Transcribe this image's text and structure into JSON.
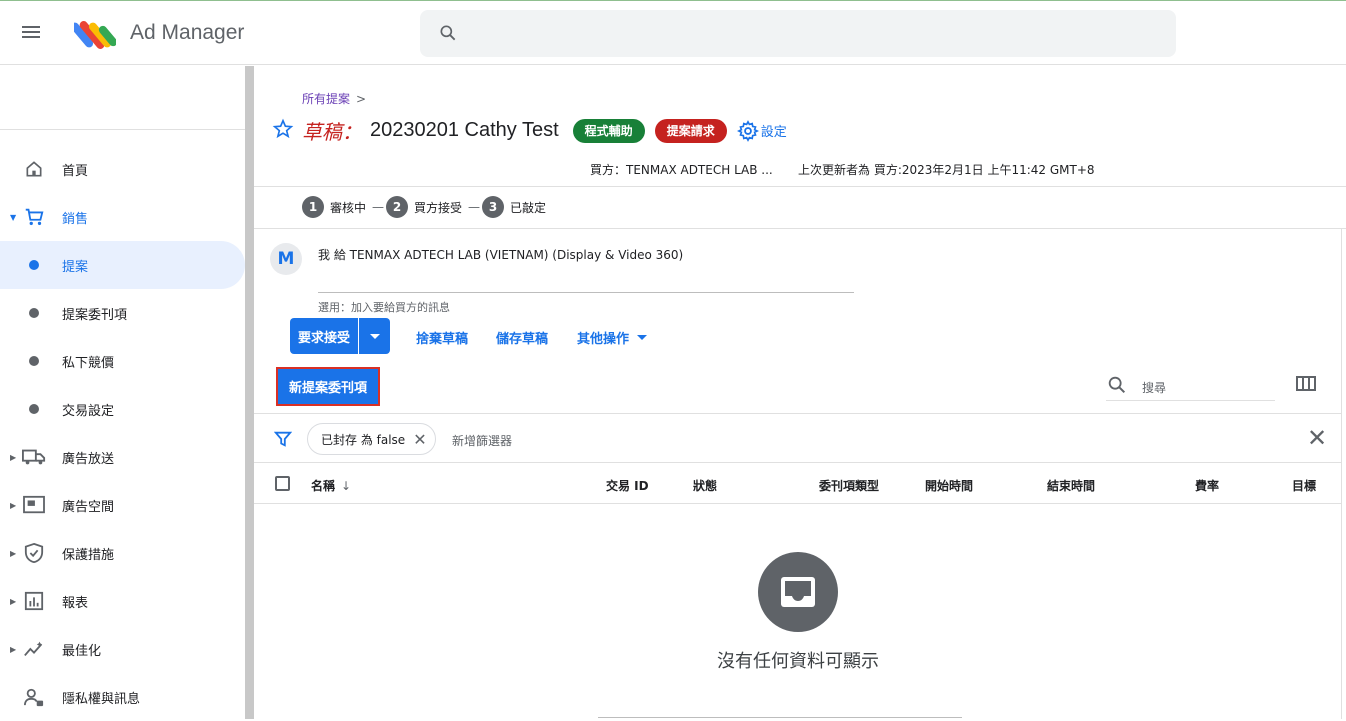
{
  "app": {
    "title": "Ad Manager"
  },
  "search": {
    "placeholder": ""
  },
  "sidebar": {
    "items": [
      {
        "label": "首頁",
        "icon": "home-icon"
      },
      {
        "label": "銷售",
        "icon": "cart-icon",
        "expanded": true
      },
      {
        "label": "提案",
        "icon": "dot",
        "selected": true
      },
      {
        "label": "提案委刊項",
        "icon": "dot"
      },
      {
        "label": "私下競價",
        "icon": "dot"
      },
      {
        "label": "交易設定",
        "icon": "dot"
      },
      {
        "label": "廣告放送",
        "icon": "truck-icon"
      },
      {
        "label": "廣告空間",
        "icon": "inventory-icon"
      },
      {
        "label": "保護措施",
        "icon": "shield-icon"
      },
      {
        "label": "報表",
        "icon": "chart-icon"
      },
      {
        "label": "最佳化",
        "icon": "sparkline-icon"
      },
      {
        "label": "隱私權與訊息",
        "icon": "privacy-icon"
      }
    ]
  },
  "breadcrumb": {
    "label": "所有提案",
    "separator": ">"
  },
  "proposal": {
    "status_prefix": "草稿：",
    "name": "20230201 Cathy Test",
    "chips": [
      "程式輔助",
      "提案請求"
    ],
    "settings_label": "設定",
    "buyer": "買方：TENMAX ADTECH LAB ...",
    "last_updated": "上次更新者為 買方:2023年2月1日 上午11:42 GMT+8"
  },
  "steps": [
    {
      "num": "1",
      "label": "審核中"
    },
    {
      "num": "2",
      "label": "買方接受"
    },
    {
      "num": "3",
      "label": "已敲定"
    }
  ],
  "message": {
    "avatar": "M",
    "text": "我 給 TENMAX ADTECH LAB (VIETNAM) (Display & Video 360)",
    "hint": "選用：加入要給買方的訊息"
  },
  "actions": {
    "request_accept": "要求接受",
    "discard_draft": "捨棄草稿",
    "save_draft": "儲存草稿",
    "other_actions": "其他操作",
    "new_line_item": "新提案委刊項"
  },
  "table": {
    "search_placeholder": "搜尋",
    "filter_chip": "已封存 為 false",
    "add_filter": "新增篩選器",
    "columns": [
      "名稱",
      "交易 ID",
      "狀態",
      "委刊項類型",
      "開始時間",
      "結束時間",
      "費率",
      "目標"
    ],
    "empty_text": "沒有任何資料可顯示"
  },
  "colors": {
    "accent": "#1a73e8",
    "draft_red": "#c5221f",
    "chip_green": "#188038"
  }
}
